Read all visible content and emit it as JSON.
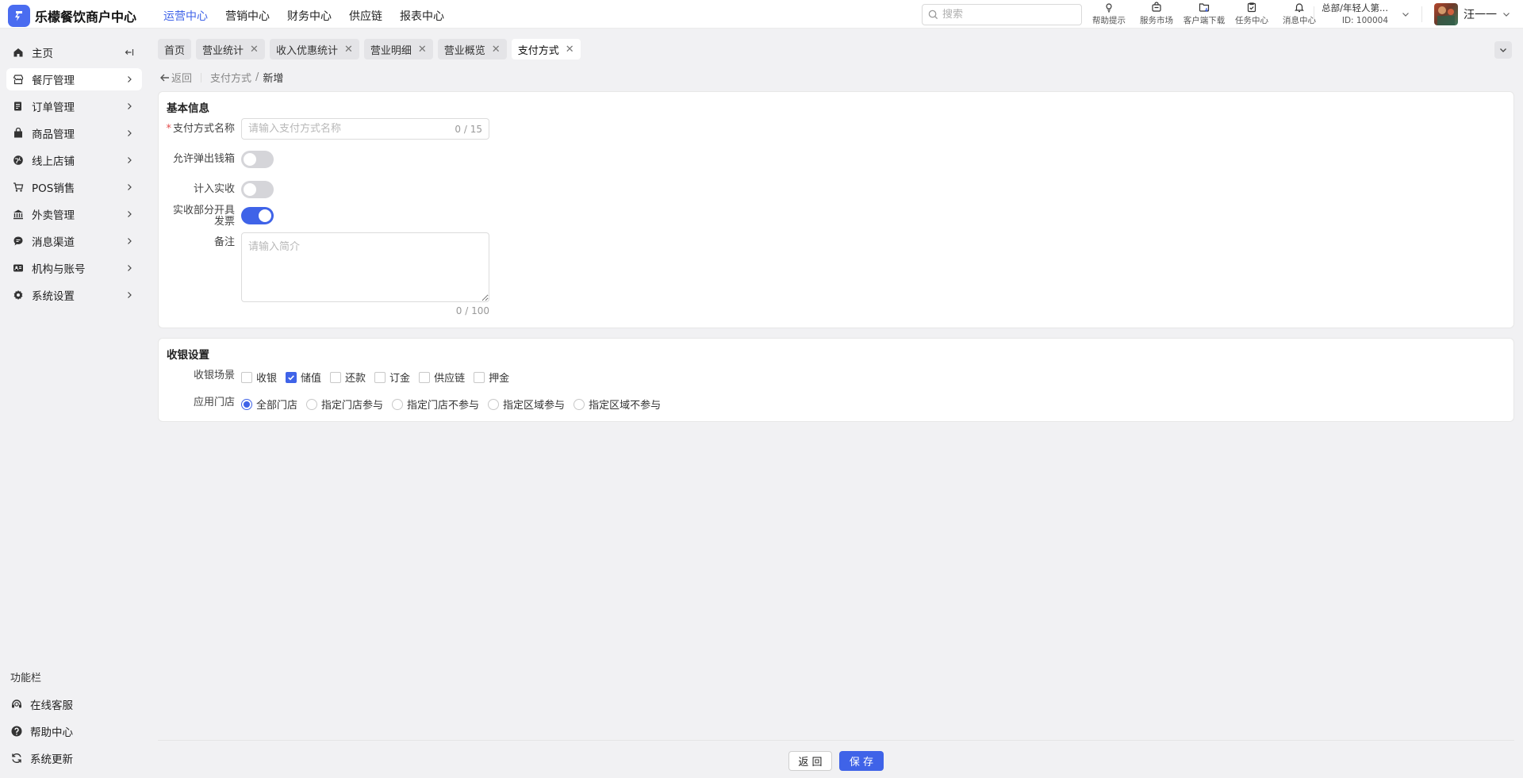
{
  "brand": {
    "name": "乐檬餐饮商户中心",
    "accent": "#3f63e8"
  },
  "top_nav": [
    {
      "label": "运营中心",
      "active": true
    },
    {
      "label": "营销中心",
      "active": false
    },
    {
      "label": "财务中心",
      "active": false
    },
    {
      "label": "供应链",
      "active": false
    },
    {
      "label": "报表中心",
      "active": false
    }
  ],
  "search": {
    "placeholder": "搜索"
  },
  "tools": [
    {
      "label": "帮助提示",
      "icon": "lightbulb-icon"
    },
    {
      "label": "服务市场",
      "icon": "shop-bag-icon"
    },
    {
      "label": "客户端下载",
      "icon": "folder-download-icon"
    },
    {
      "label": "任务中心",
      "icon": "clipboard-icon"
    },
    {
      "label": "消息中心",
      "icon": "bell-icon"
    }
  ],
  "org": {
    "name": "总部/年轻人第...",
    "id": "ID: 100004"
  },
  "user": {
    "name": "汪一一"
  },
  "sidebar": {
    "items": [
      {
        "label": "主页",
        "icon": "home-icon"
      },
      {
        "label": "餐厅管理",
        "icon": "store-icon",
        "active": true
      },
      {
        "label": "订单管理",
        "icon": "order-icon"
      },
      {
        "label": "商品管理",
        "icon": "goods-icon"
      },
      {
        "label": "线上店铺",
        "icon": "globe-icon"
      },
      {
        "label": "POS销售",
        "icon": "cart-icon"
      },
      {
        "label": "外卖管理",
        "icon": "bank-icon"
      },
      {
        "label": "消息渠道",
        "icon": "chat-icon"
      },
      {
        "label": "机构与账号",
        "icon": "id-card-icon"
      },
      {
        "label": "系统设置",
        "icon": "gear-icon"
      }
    ],
    "function_title": "功能栏",
    "functions": [
      {
        "label": "在线客服",
        "icon": "headset-icon"
      },
      {
        "label": "帮助中心",
        "icon": "help-icon"
      },
      {
        "label": "系统更新",
        "icon": "refresh-icon"
      }
    ]
  },
  "tabs": [
    {
      "label": "首页",
      "closable": false,
      "active": false
    },
    {
      "label": "营业统计",
      "closable": true,
      "active": false
    },
    {
      "label": "收入优惠统计",
      "closable": true,
      "active": false
    },
    {
      "label": "营业明细",
      "closable": true,
      "active": false
    },
    {
      "label": "营业概览",
      "closable": true,
      "active": false
    },
    {
      "label": "支付方式",
      "closable": true,
      "active": true
    }
  ],
  "breadcrumb": {
    "back": "返回",
    "parent": "支付方式",
    "separator": "/",
    "current": "新增"
  },
  "basic": {
    "title": "基本信息",
    "name_label": "支付方式名称",
    "name_placeholder": "请输入支付方式名称",
    "name_value": "",
    "name_counter": "0 / 15",
    "drawer_label": "允许弹出钱箱",
    "drawer_on": false,
    "income_label": "计入实收",
    "income_on": false,
    "invoice_label": "实收部分开具发票",
    "invoice_on": true,
    "remark_label": "备注",
    "remark_placeholder": "请输入简介",
    "remark_counter": "0 / 100"
  },
  "cashier": {
    "title": "收银设置",
    "scene_label": "收银场景",
    "scenes": [
      {
        "label": "收银",
        "checked": false
      },
      {
        "label": "储值",
        "checked": true
      },
      {
        "label": "还款",
        "checked": false
      },
      {
        "label": "订金",
        "checked": false
      },
      {
        "label": "供应链",
        "checked": false
      },
      {
        "label": "押金",
        "checked": false
      }
    ],
    "store_label": "应用门店",
    "stores": [
      {
        "label": "全部门店",
        "selected": true
      },
      {
        "label": "指定门店参与",
        "selected": false
      },
      {
        "label": "指定门店不参与",
        "selected": false
      },
      {
        "label": "指定区域参与",
        "selected": false
      },
      {
        "label": "指定区域不参与",
        "selected": false
      }
    ]
  },
  "footer": {
    "back_label": "返 回",
    "save_label": "保 存"
  }
}
